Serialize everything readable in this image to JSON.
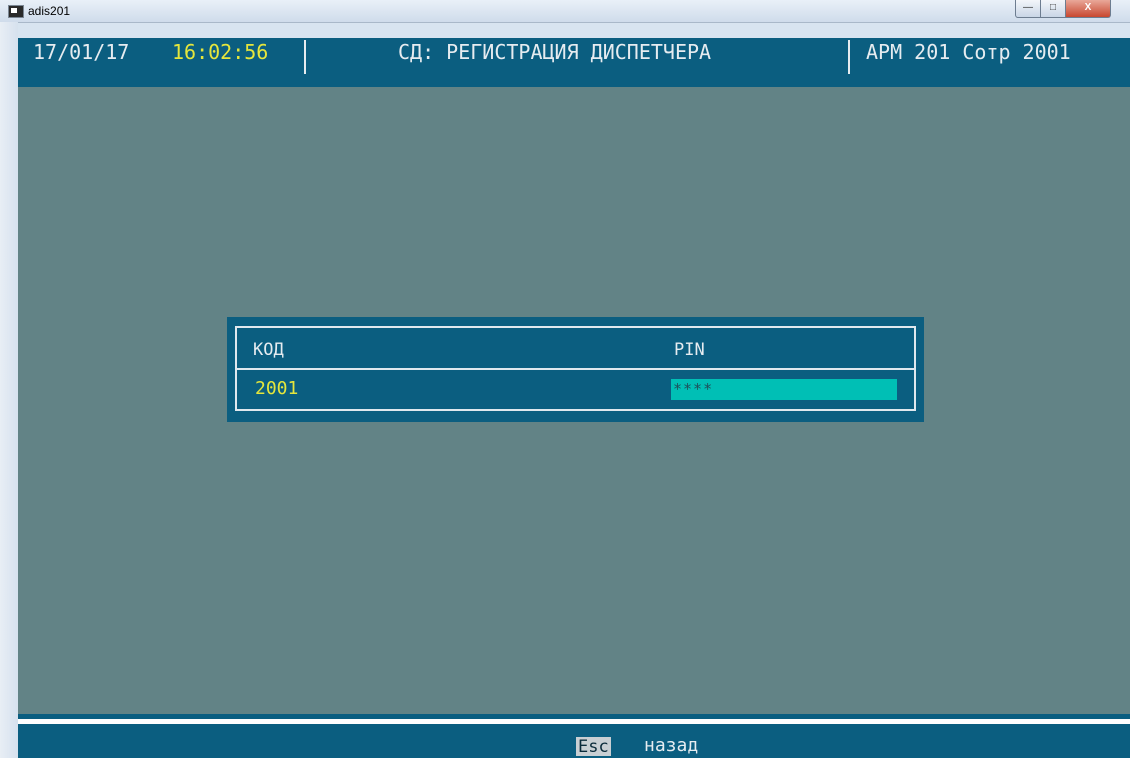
{
  "window": {
    "title": "adis201",
    "controls": {
      "minimize": "—",
      "maximize": "□",
      "close": "X"
    }
  },
  "header": {
    "date": "17/01/17",
    "time": "16:02:56",
    "title": "СД: РЕГИСТРАЦИЯ ДИСПЕТЧЕРА",
    "workstation": "АРМ 201 Сотр 2001",
    "time_color": "#e5e63c",
    "bg_color": "#0b5e80"
  },
  "dialog": {
    "code_label": "КОД",
    "pin_label": "PIN",
    "code_value": "2001",
    "pin_value": "****",
    "pin_field_color": "#00bfb5"
  },
  "footer": {
    "key": "Esc",
    "action": "назад"
  },
  "colors": {
    "console_bg": "#628386",
    "accent_yellow": "#e5e63c"
  }
}
